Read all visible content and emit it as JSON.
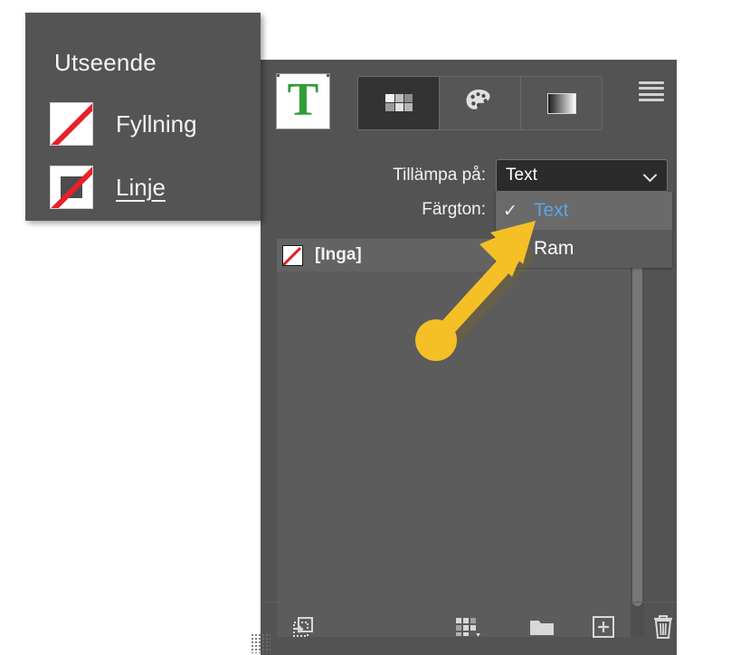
{
  "appearance_panel": {
    "title": "Utseende",
    "rows": [
      {
        "label": "Fyllning",
        "icon": "fill-none-swatch-icon",
        "underlined": false
      },
      {
        "label": "Linje",
        "icon": "stroke-none-swatch-icon",
        "underlined": true
      }
    ]
  },
  "swatches_panel": {
    "type_preview": {
      "glyph": "T",
      "color": "#2f9e34"
    },
    "mode_buttons": [
      {
        "name": "swatches-mode-button",
        "icon": "swatch-grid-icon",
        "active": true
      },
      {
        "name": "color-mode-button",
        "icon": "color-palette-icon",
        "active": false
      },
      {
        "name": "gradient-mode-button",
        "icon": "gradient-icon",
        "active": false
      }
    ],
    "menu_icon": "hamburger-menu-icon",
    "apply_to": {
      "label": "Tillämpa på:",
      "value": "Text",
      "options": [
        {
          "label": "Text",
          "selected": true,
          "check": "✓"
        },
        {
          "label": "Ram",
          "selected": false,
          "check": ""
        }
      ]
    },
    "tint": {
      "label": "Färgton:"
    },
    "swatch_rows": [
      {
        "name": "[Inga]",
        "chip": "none-swatch-icon",
        "usage_icon": "crossed-pen-icon",
        "thumb": "none-swatch-thumb-icon",
        "selected": true
      }
    ],
    "footer_buttons": [
      {
        "name": "show-swatch-group-button",
        "icon": "show-swatch-group-icon"
      },
      {
        "name": "new-color-group-button",
        "icon": "swatch-group-icon"
      },
      {
        "name": "open-folder-button",
        "icon": "folder-icon"
      },
      {
        "name": "new-swatch-button",
        "icon": "new-swatch-plus-icon"
      },
      {
        "name": "delete-swatch-button",
        "icon": "trash-icon"
      }
    ]
  },
  "annotation": {
    "arrow_color": "#F5C026",
    "direction": "up-right"
  }
}
